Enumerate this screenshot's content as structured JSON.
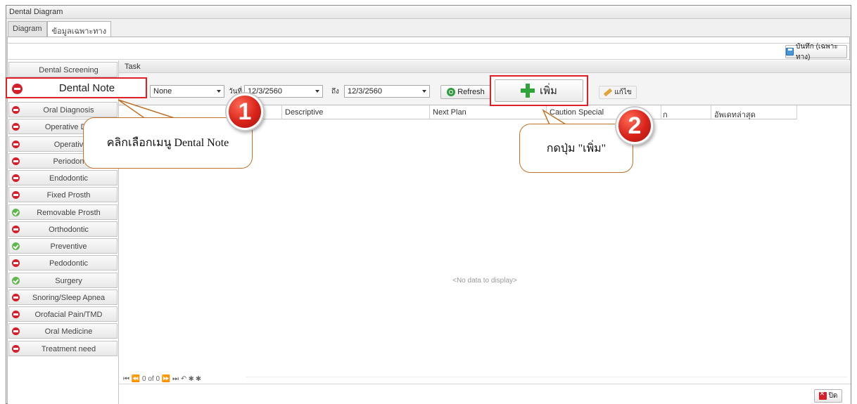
{
  "window": {
    "title": "Dental Diagram"
  },
  "tabs": [
    {
      "label": "Diagram"
    },
    {
      "label": "ข้อมูลเฉพาะทาง"
    }
  ],
  "topbar": {
    "save_label": "บันทึก (เฉพาะทาง)"
  },
  "menu": {
    "header": "Dental Screening",
    "selected": "Dental Note",
    "items": [
      {
        "label": "Oral Diagnosis",
        "status": "no"
      },
      {
        "label": "Operative Dia",
        "status": "no"
      },
      {
        "label": "Operativ",
        "status": "no"
      },
      {
        "label": "Periodon",
        "status": "no"
      },
      {
        "label": "Endodontic",
        "status": "no"
      },
      {
        "label": "Fixed Prosth",
        "status": "no"
      },
      {
        "label": "Removable Prosth",
        "status": "ok"
      },
      {
        "label": "Orthodontic",
        "status": "no"
      },
      {
        "label": "Preventive",
        "status": "ok"
      },
      {
        "label": "Pedodontic",
        "status": "no"
      },
      {
        "label": "Surgery",
        "status": "ok"
      },
      {
        "label": "Snoring/Sleep Apnea",
        "status": "no"
      },
      {
        "label": "Orofacial Pain/TMD",
        "status": "no"
      },
      {
        "label": "Oral Medicine",
        "status": "no"
      },
      {
        "label": "Treatment need",
        "status": "no"
      }
    ]
  },
  "task": {
    "header": "Task",
    "filter_value": "None",
    "date_from_label": "วันที่",
    "date_from": "12/3/2560",
    "date_to_label": "ถึง",
    "date_to": "12/3/2560",
    "refresh_label": "Refresh",
    "add_label": "เพิ่ม",
    "edit_label": "แก้ไข"
  },
  "grid": {
    "columns": [
      "",
      "Descriptive",
      "Next Plan",
      "Caution Special",
      "ก",
      "อัพเดทล่าสุด"
    ],
    "empty_text": "<No data to display>",
    "navigator": "⏮ ⏪  0 of 0  ⏩ ⏭ ↶ ✱ ✱"
  },
  "footer": {
    "close_label": "ปิด"
  },
  "annotations": {
    "step1_number": "1",
    "step1_text": "คลิกเลือกเมนู Dental Note",
    "step2_number": "2",
    "step2_text": "กดปุ่ม \"เพิ่ม\""
  }
}
